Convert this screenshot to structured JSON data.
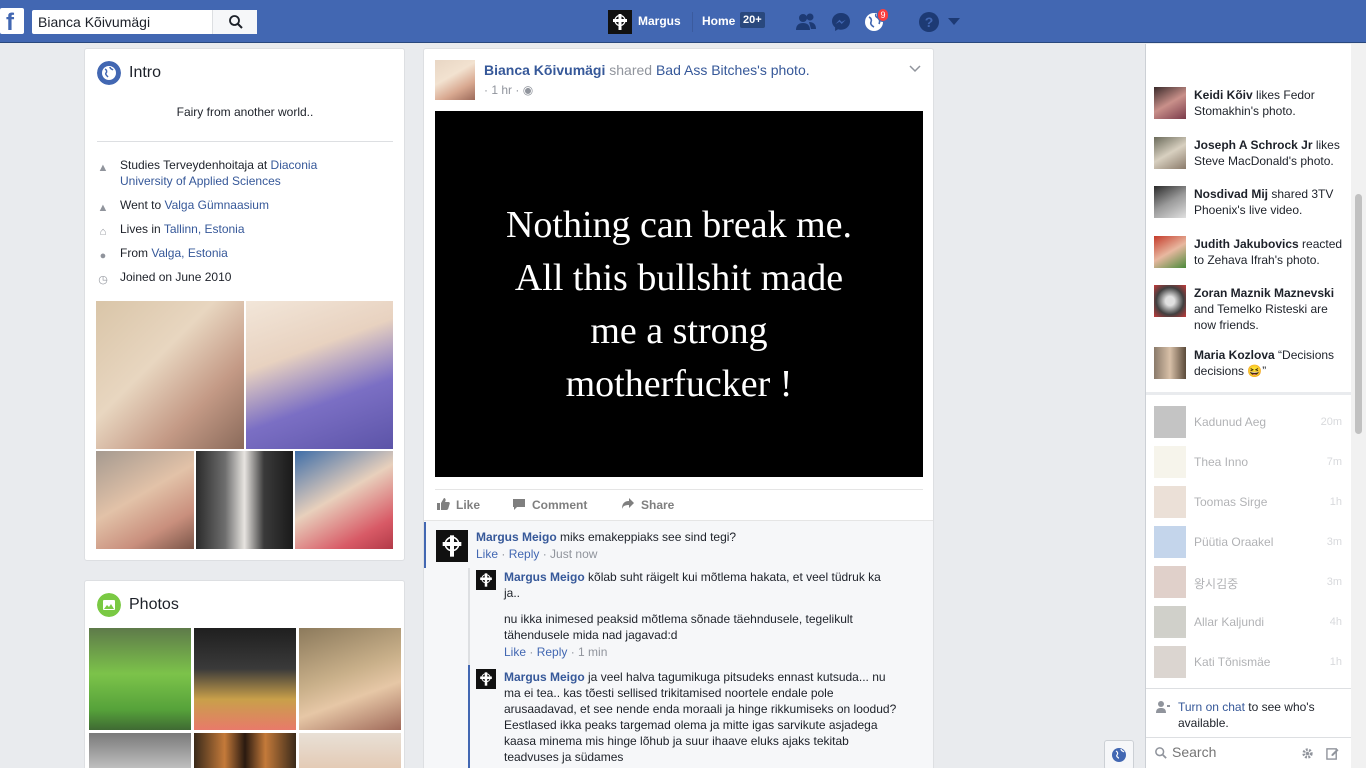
{
  "topbar": {
    "search_value": "Bianca Kõivumägi",
    "user_name": "Margus",
    "home_label": "Home",
    "home_count": "20+",
    "notifications_count": "9",
    "brand_color": "#4267b2"
  },
  "intro": {
    "title": "Intro",
    "bio": "Fairy from another world..",
    "study_prefix": "Studies Terveydenhoitaja at ",
    "study_link": "Diaconia University of Applied Sciences",
    "went_prefix": "Went to ",
    "went_link": "Valga Gümnaasium",
    "lives_prefix": "Lives in ",
    "lives_link": "Tallinn, Estonia",
    "from_prefix": "From ",
    "from_link": "Valga, Estonia",
    "joined": "Joined on June 2010"
  },
  "photos": {
    "title": "Photos"
  },
  "post": {
    "author": "Bianca Kõivumägi",
    "shared_text": " shared ",
    "page_name": "Bad Ass Bitches",
    "photo_suffix": "'s photo.",
    "time": "1 hr",
    "image_text": [
      "Nothing can break me.",
      "All this bullshit made",
      "me a strong",
      "motherfucker !"
    ],
    "actions": {
      "like": "Like",
      "comment": "Comment",
      "share": "Share"
    }
  },
  "comments": [
    {
      "author": "Margus Meigo",
      "text": "miks emakeppiaks see sind tegi?",
      "like": "Like",
      "reply": "Reply",
      "time": "Just now"
    },
    {
      "author": "Margus Meigo",
      "text": "kõlab suht räigelt kui mõtlema hakata, et veel tüdruk ka ja..",
      "text2": "nu ikka inimesed peaksid mõtlema sõnade täehndusele, tegelikult tähendusele mida nad jagavad:d",
      "like": "Like",
      "reply": "Reply",
      "time": "1 min"
    },
    {
      "author": "Margus Meigo",
      "text": "ja veel halva tagumikuga pitsudeks ennast kutsuda... nu ma ei tea.. kas tõesti sellised trikitamised noortele endale pole arusaadavad, et see nende enda moraali ja hinge rikkumiseks on loodud? Eestlased ikka peaks targemad olema ja mitte igas sarvikute asjadega kaasa minema mis hinge lõhub ja suur ihaave eluks ajaks tekitab teadvuses ja südames"
    }
  ],
  "ticker": [
    {
      "name": "Keidi Kõiv",
      "text": " likes Fedor Stomakhin's photo."
    },
    {
      "name": "Joseph A Schrock Jr",
      "text": " likes Steve MacDonald's photo."
    },
    {
      "name": "Nosdivad Mij",
      "text": " shared 3TV Phoenix's live video."
    },
    {
      "name": "Judith Jakubovics",
      "text": " reacted to Zehava Ifrah's photo."
    },
    {
      "name": "Zoran Maznik Maznevski",
      "text": " and Temelko Risteski are now friends."
    },
    {
      "name": "Maria Kozlova",
      "text": " “Decisions decisions 😆”"
    }
  ],
  "chat": [
    {
      "name": "Kadunud Aeg",
      "time": "20m"
    },
    {
      "name": "Thea Inno",
      "time": "7m"
    },
    {
      "name": "Toomas Sirge",
      "time": "1h"
    },
    {
      "name": "Püütia Oraakel",
      "time": "3m"
    },
    {
      "name": "왕시김중",
      "time": "3m"
    },
    {
      "name": "Allar Kaljundi",
      "time": "4h"
    },
    {
      "name": "Kati Tõnismäe",
      "time": "1h"
    }
  ],
  "chat_off": {
    "link": "Turn on chat",
    "text": " to see who's available."
  },
  "chat_search": {
    "placeholder": "Search"
  }
}
